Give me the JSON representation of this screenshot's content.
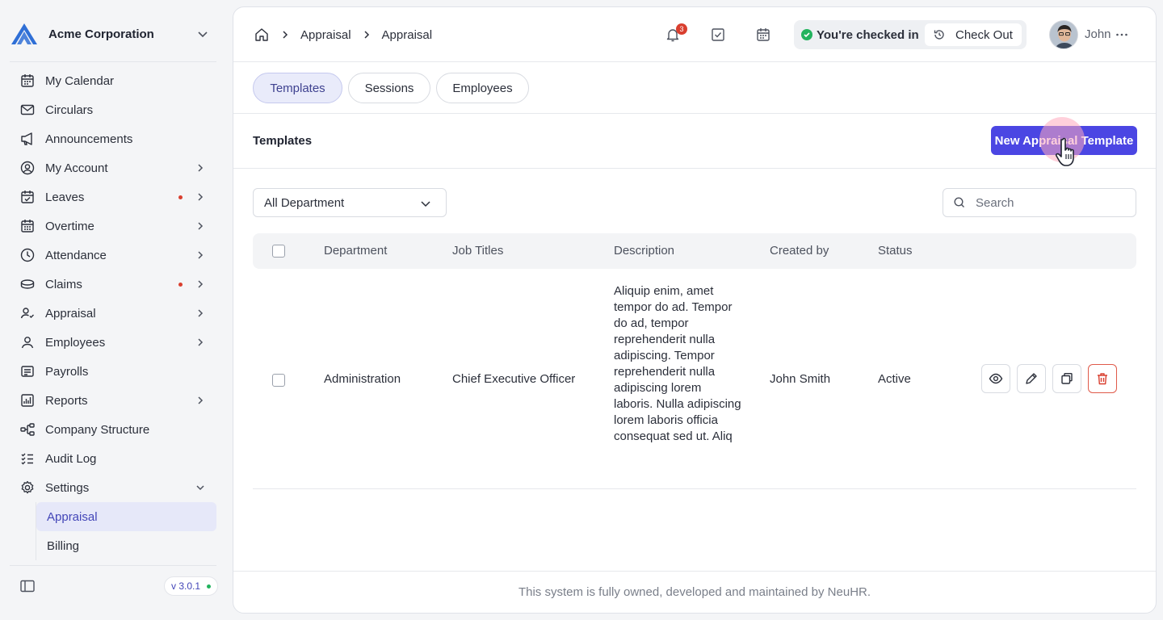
{
  "org": {
    "name": "Acme Corporation"
  },
  "sidebar": {
    "items": [
      {
        "label": "My Calendar",
        "icon": "calendar-icon"
      },
      {
        "label": "Circulars",
        "icon": "mail-icon"
      },
      {
        "label": "Announcements",
        "icon": "megaphone-icon"
      },
      {
        "label": "My Account",
        "icon": "user-circle-icon",
        "expandable": true
      },
      {
        "label": "Leaves",
        "icon": "calendar-check-icon",
        "expandable": true,
        "notify": true
      },
      {
        "label": "Overtime",
        "icon": "calendar-clock-icon",
        "expandable": true
      },
      {
        "label": "Attendance",
        "icon": "clock-icon",
        "expandable": true
      },
      {
        "label": "Claims",
        "icon": "coins-icon",
        "expandable": true,
        "notify": true
      },
      {
        "label": "Appraisal",
        "icon": "user-check-icon",
        "expandable": true
      },
      {
        "label": "Employees",
        "icon": "user-icon",
        "expandable": true
      },
      {
        "label": "Payrolls",
        "icon": "receipt-icon"
      },
      {
        "label": "Reports",
        "icon": "chart-icon",
        "expandable": true
      },
      {
        "label": "Company Structure",
        "icon": "hierarchy-icon"
      },
      {
        "label": "Audit Log",
        "icon": "checklist-icon"
      },
      {
        "label": "Settings",
        "icon": "gear-icon",
        "expanded": true
      }
    ],
    "settings_sub": [
      {
        "label": "Appraisal",
        "active": true
      },
      {
        "label": "Billing",
        "active": false
      }
    ],
    "version": "v 3.0.1"
  },
  "topbar": {
    "breadcrumbs": [
      "Appraisal",
      "Appraisal"
    ],
    "notifications_count": "3",
    "checkin_status": "You're checked in",
    "checkout_label": "Check Out",
    "user_name": "John"
  },
  "tabs": [
    "Templates",
    "Sessions",
    "Employees"
  ],
  "active_tab": "Templates",
  "section": {
    "title": "Templates",
    "new_button": "New Appraisal Template"
  },
  "filters": {
    "department": "All Department",
    "search_placeholder": "Search"
  },
  "table": {
    "columns": [
      "Department",
      "Job Titles",
      "Description",
      "Created by",
      "Status"
    ],
    "rows": [
      {
        "department": "Administration",
        "job_title": "Chief Executive Officer",
        "description": "Aliquip enim, amet tempor do ad. Tempor do ad, tempor reprehenderit nulla adipiscing. Tempor reprehenderit nulla adipiscing lorem laboris. Nulla adipiscing lorem laboris officia consequat sed ut. Aliq",
        "created_by": "John Smith",
        "status": "Active"
      }
    ]
  },
  "footer": {
    "text": "This system is fully owned, developed and maintained by NeuHR."
  },
  "colors": {
    "accent": "#4b46e3",
    "active_tab_bg": "#e9ebfa",
    "danger": "#d93f2f",
    "success": "#22b35e"
  }
}
